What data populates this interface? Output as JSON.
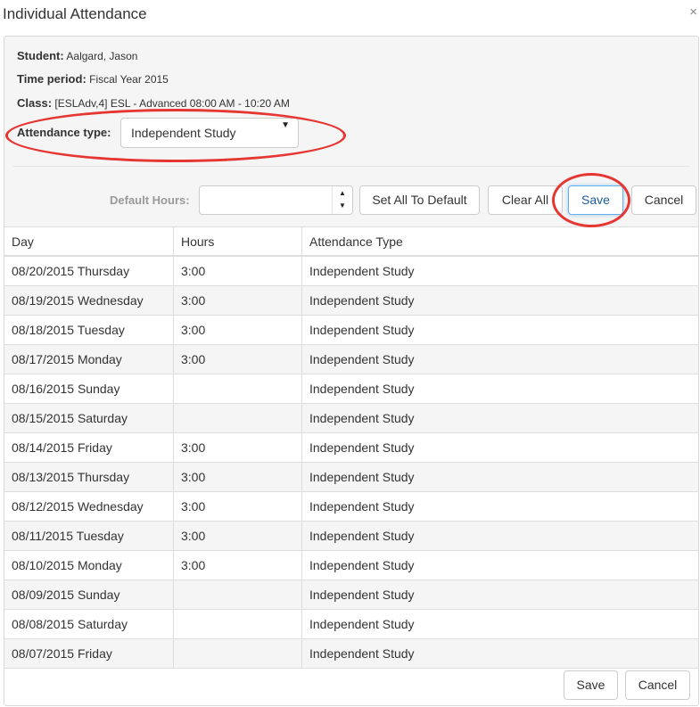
{
  "dialog": {
    "title": "Individual Attendance",
    "close_glyph": "×"
  },
  "info": {
    "student_label": "Student:",
    "student_value": "Aalgard, Jason",
    "period_label": "Time period:",
    "period_value": "Fiscal Year 2015",
    "class_label": "Class:",
    "class_value": "[ESLAdv,4] ESL - Advanced 08:00 AM - 10:20 AM",
    "attendance_type_label": "Attendance type:",
    "attendance_type_value": "Independent Study"
  },
  "toolbar": {
    "default_hours_label": "Default Hours:",
    "default_hours_value": "",
    "set_all_label": "Set All To Default",
    "clear_all_label": "Clear All",
    "save_label": "Save",
    "cancel_label": "Cancel"
  },
  "table": {
    "headers": [
      "Day",
      "Hours",
      "Attendance Type"
    ],
    "rows": [
      [
        "08/20/2015 Thursday",
        "3:00",
        "Independent Study"
      ],
      [
        "08/19/2015 Wednesday",
        "3:00",
        "Independent Study"
      ],
      [
        "08/18/2015 Tuesday",
        "3:00",
        "Independent Study"
      ],
      [
        "08/17/2015 Monday",
        "3:00",
        "Independent Study"
      ],
      [
        "08/16/2015 Sunday",
        "",
        "Independent Study"
      ],
      [
        "08/15/2015 Saturday",
        "",
        "Independent Study"
      ],
      [
        "08/14/2015 Friday",
        "3:00",
        "Independent Study"
      ],
      [
        "08/13/2015 Thursday",
        "3:00",
        "Independent Study"
      ],
      [
        "08/12/2015 Wednesday",
        "3:00",
        "Independent Study"
      ],
      [
        "08/11/2015 Tuesday",
        "3:00",
        "Independent Study"
      ],
      [
        "08/10/2015 Monday",
        "3:00",
        "Independent Study"
      ],
      [
        "08/09/2015 Sunday",
        "",
        "Independent Study"
      ],
      [
        "08/08/2015 Saturday",
        "",
        "Independent Study"
      ],
      [
        "08/07/2015 Friday",
        "",
        "Independent Study"
      ]
    ]
  },
  "footer": {
    "save_label": "Save",
    "cancel_label": "Cancel"
  },
  "annotations": {
    "highlight_color": "#e63632"
  },
  "icons": {
    "close": "close-icon",
    "select_caret": "caret-down-icon",
    "spinner": "spinner-arrows-icon"
  }
}
